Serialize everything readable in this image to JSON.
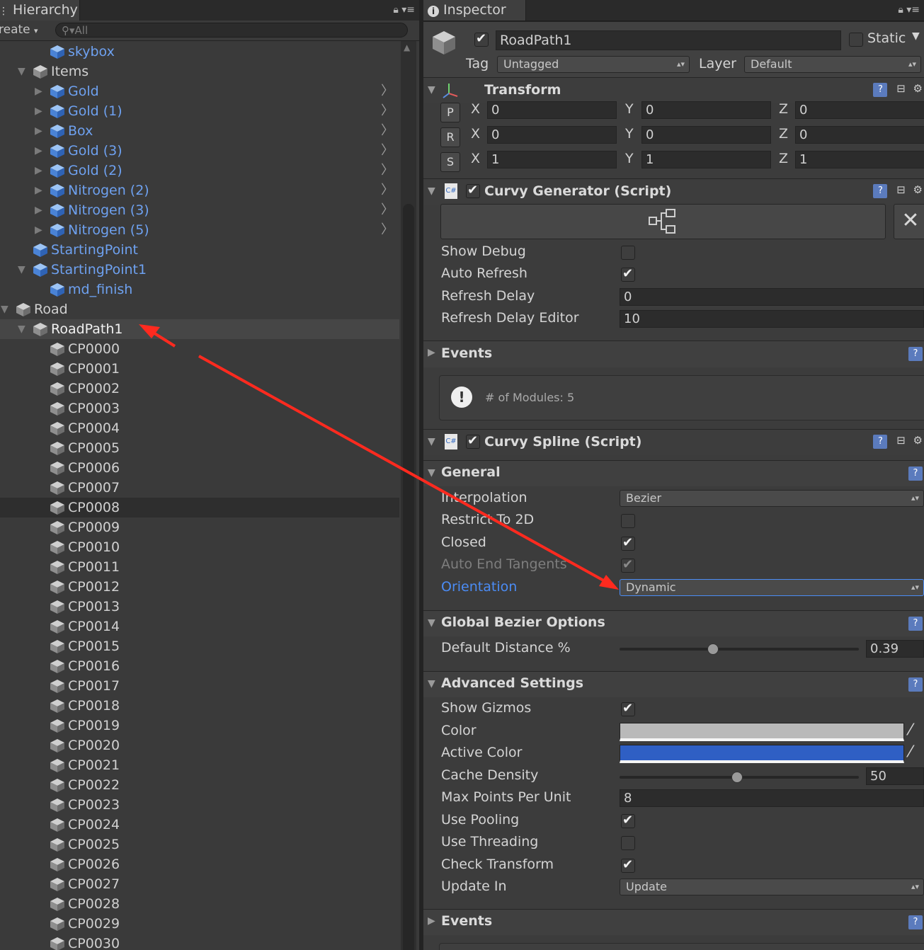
{
  "hierarchy": {
    "tab": "Hierarchy",
    "create": "reate",
    "search_placeholder": "All",
    "rows": [
      {
        "label": "skybox",
        "indent": 3,
        "arrow": "",
        "style": "pref",
        "chev": false
      },
      {
        "label": "Items",
        "indent": 2,
        "arrow": "down",
        "style": "plain",
        "chev": false
      },
      {
        "label": "Gold",
        "indent": 3,
        "arrow": "right",
        "style": "pref",
        "chev": true
      },
      {
        "label": "Gold (1)",
        "indent": 3,
        "arrow": "right",
        "style": "pref",
        "chev": true
      },
      {
        "label": "Box",
        "indent": 3,
        "arrow": "right",
        "style": "pref",
        "chev": true
      },
      {
        "label": "Gold (3)",
        "indent": 3,
        "arrow": "right",
        "style": "pref",
        "chev": true
      },
      {
        "label": "Gold (2)",
        "indent": 3,
        "arrow": "right",
        "style": "pref",
        "chev": true
      },
      {
        "label": "Nitrogen (2)",
        "indent": 3,
        "arrow": "right",
        "style": "pref",
        "chev": true
      },
      {
        "label": "Nitrogen (3)",
        "indent": 3,
        "arrow": "right",
        "style": "pref",
        "chev": true
      },
      {
        "label": "Nitrogen (5)",
        "indent": 3,
        "arrow": "right",
        "style": "pref",
        "chev": true
      },
      {
        "label": "StartingPoint",
        "indent": 2,
        "arrow": "",
        "style": "pref",
        "chev": false
      },
      {
        "label": "StartingPoint1",
        "indent": 2,
        "arrow": "down",
        "style": "pref",
        "chev": false
      },
      {
        "label": "md_finish",
        "indent": 3,
        "arrow": "",
        "style": "pref",
        "chev": false
      },
      {
        "label": "Road",
        "indent": 1,
        "arrow": "down",
        "style": "plain",
        "chev": false
      },
      {
        "label": "RoadPath1",
        "indent": 2,
        "arrow": "down",
        "style": "white",
        "chev": false,
        "selected": true
      },
      {
        "label": "CP0000",
        "indent": 3,
        "arrow": "",
        "style": "plain",
        "chev": false
      },
      {
        "label": "CP0001",
        "indent": 3,
        "arrow": "",
        "style": "plain",
        "chev": false
      },
      {
        "label": "CP0002",
        "indent": 3,
        "arrow": "",
        "style": "plain",
        "chev": false
      },
      {
        "label": "CP0003",
        "indent": 3,
        "arrow": "",
        "style": "plain",
        "chev": false
      },
      {
        "label": "CP0004",
        "indent": 3,
        "arrow": "",
        "style": "plain",
        "chev": false
      },
      {
        "label": "CP0005",
        "indent": 3,
        "arrow": "",
        "style": "plain",
        "chev": false
      },
      {
        "label": "CP0006",
        "indent": 3,
        "arrow": "",
        "style": "plain",
        "chev": false
      },
      {
        "label": "CP0007",
        "indent": 3,
        "arrow": "",
        "style": "plain",
        "chev": false
      },
      {
        "label": "CP0008",
        "indent": 3,
        "arrow": "",
        "style": "plain",
        "chev": false,
        "hover": true
      },
      {
        "label": "CP0009",
        "indent": 3,
        "arrow": "",
        "style": "plain",
        "chev": false
      },
      {
        "label": "CP0010",
        "indent": 3,
        "arrow": "",
        "style": "plain",
        "chev": false
      },
      {
        "label": "CP0011",
        "indent": 3,
        "arrow": "",
        "style": "plain",
        "chev": false
      },
      {
        "label": "CP0012",
        "indent": 3,
        "arrow": "",
        "style": "plain",
        "chev": false
      },
      {
        "label": "CP0013",
        "indent": 3,
        "arrow": "",
        "style": "plain",
        "chev": false
      },
      {
        "label": "CP0014",
        "indent": 3,
        "arrow": "",
        "style": "plain",
        "chev": false
      },
      {
        "label": "CP0015",
        "indent": 3,
        "arrow": "",
        "style": "plain",
        "chev": false
      },
      {
        "label": "CP0016",
        "indent": 3,
        "arrow": "",
        "style": "plain",
        "chev": false
      },
      {
        "label": "CP0017",
        "indent": 3,
        "arrow": "",
        "style": "plain",
        "chev": false
      },
      {
        "label": "CP0018",
        "indent": 3,
        "arrow": "",
        "style": "plain",
        "chev": false
      },
      {
        "label": "CP0019",
        "indent": 3,
        "arrow": "",
        "style": "plain",
        "chev": false
      },
      {
        "label": "CP0020",
        "indent": 3,
        "arrow": "",
        "style": "plain",
        "chev": false
      },
      {
        "label": "CP0021",
        "indent": 3,
        "arrow": "",
        "style": "plain",
        "chev": false
      },
      {
        "label": "CP0022",
        "indent": 3,
        "arrow": "",
        "style": "plain",
        "chev": false
      },
      {
        "label": "CP0023",
        "indent": 3,
        "arrow": "",
        "style": "plain",
        "chev": false
      },
      {
        "label": "CP0024",
        "indent": 3,
        "arrow": "",
        "style": "plain",
        "chev": false
      },
      {
        "label": "CP0025",
        "indent": 3,
        "arrow": "",
        "style": "plain",
        "chev": false
      },
      {
        "label": "CP0026",
        "indent": 3,
        "arrow": "",
        "style": "plain",
        "chev": false
      },
      {
        "label": "CP0027",
        "indent": 3,
        "arrow": "",
        "style": "plain",
        "chev": false
      },
      {
        "label": "CP0028",
        "indent": 3,
        "arrow": "",
        "style": "plain",
        "chev": false
      },
      {
        "label": "CP0029",
        "indent": 3,
        "arrow": "",
        "style": "plain",
        "chev": false
      },
      {
        "label": "CP0030",
        "indent": 3,
        "arrow": "",
        "style": "plain",
        "chev": false
      }
    ]
  },
  "inspector": {
    "tab": "Inspector",
    "object_name": "RoadPath1",
    "static_label": "Static",
    "tag_label": "Tag",
    "tag_value": "Untagged",
    "layer_label": "Layer",
    "layer_value": "Default",
    "transform": {
      "title": "Transform",
      "rows": [
        {
          "btn": "P",
          "x": "0",
          "y": "0",
          "z": "0"
        },
        {
          "btn": "R",
          "x": "0",
          "y": "0",
          "z": "0"
        },
        {
          "btn": "S",
          "x": "1",
          "y": "1",
          "z": "1"
        }
      ],
      "axis_x": "X",
      "axis_y": "Y",
      "axis_z": "Z"
    },
    "generator": {
      "title": "Curvy Generator (Script)",
      "show_debug": "Show Debug",
      "auto_refresh": "Auto Refresh",
      "refresh_delay": "Refresh Delay",
      "refresh_delay_value": "0",
      "refresh_delay_editor": "Refresh Delay Editor",
      "refresh_delay_editor_value": "10",
      "events": "Events",
      "modules_msg": "# of Modules: 5"
    },
    "spline": {
      "title": "Curvy Spline (Script)",
      "general": "General",
      "interpolation": "Interpolation",
      "interpolation_value": "Bezier",
      "restrict": "Restrict To 2D",
      "closed": "Closed",
      "auto_end": "Auto End Tangents",
      "orientation": "Orientation",
      "orientation_value": "Dynamic",
      "bezier_options": "Global Bezier Options",
      "default_distance": "Default Distance %",
      "default_distance_value": "0.39",
      "default_distance_level": 0.39,
      "advanced": "Advanced Settings",
      "show_gizmos": "Show Gizmos",
      "color": "Color",
      "color_hex": "#b9b9b9",
      "active_color": "Active Color",
      "active_color_hex": "#2f5fc4",
      "cache_density": "Cache Density",
      "cache_density_value": "50",
      "cache_density_level": 0.49,
      "max_points": "Max Points Per Unit",
      "max_points_value": "8",
      "use_pooling": "Use Pooling",
      "use_threading": "Use Threading",
      "check_transform": "Check Transform",
      "update_in": "Update In",
      "update_in_value": "Update",
      "events": "Events"
    }
  },
  "colors": {
    "annotation": "#ff2a1f",
    "prefab": "#6ea1f0",
    "accent": "#4b8cf5"
  }
}
